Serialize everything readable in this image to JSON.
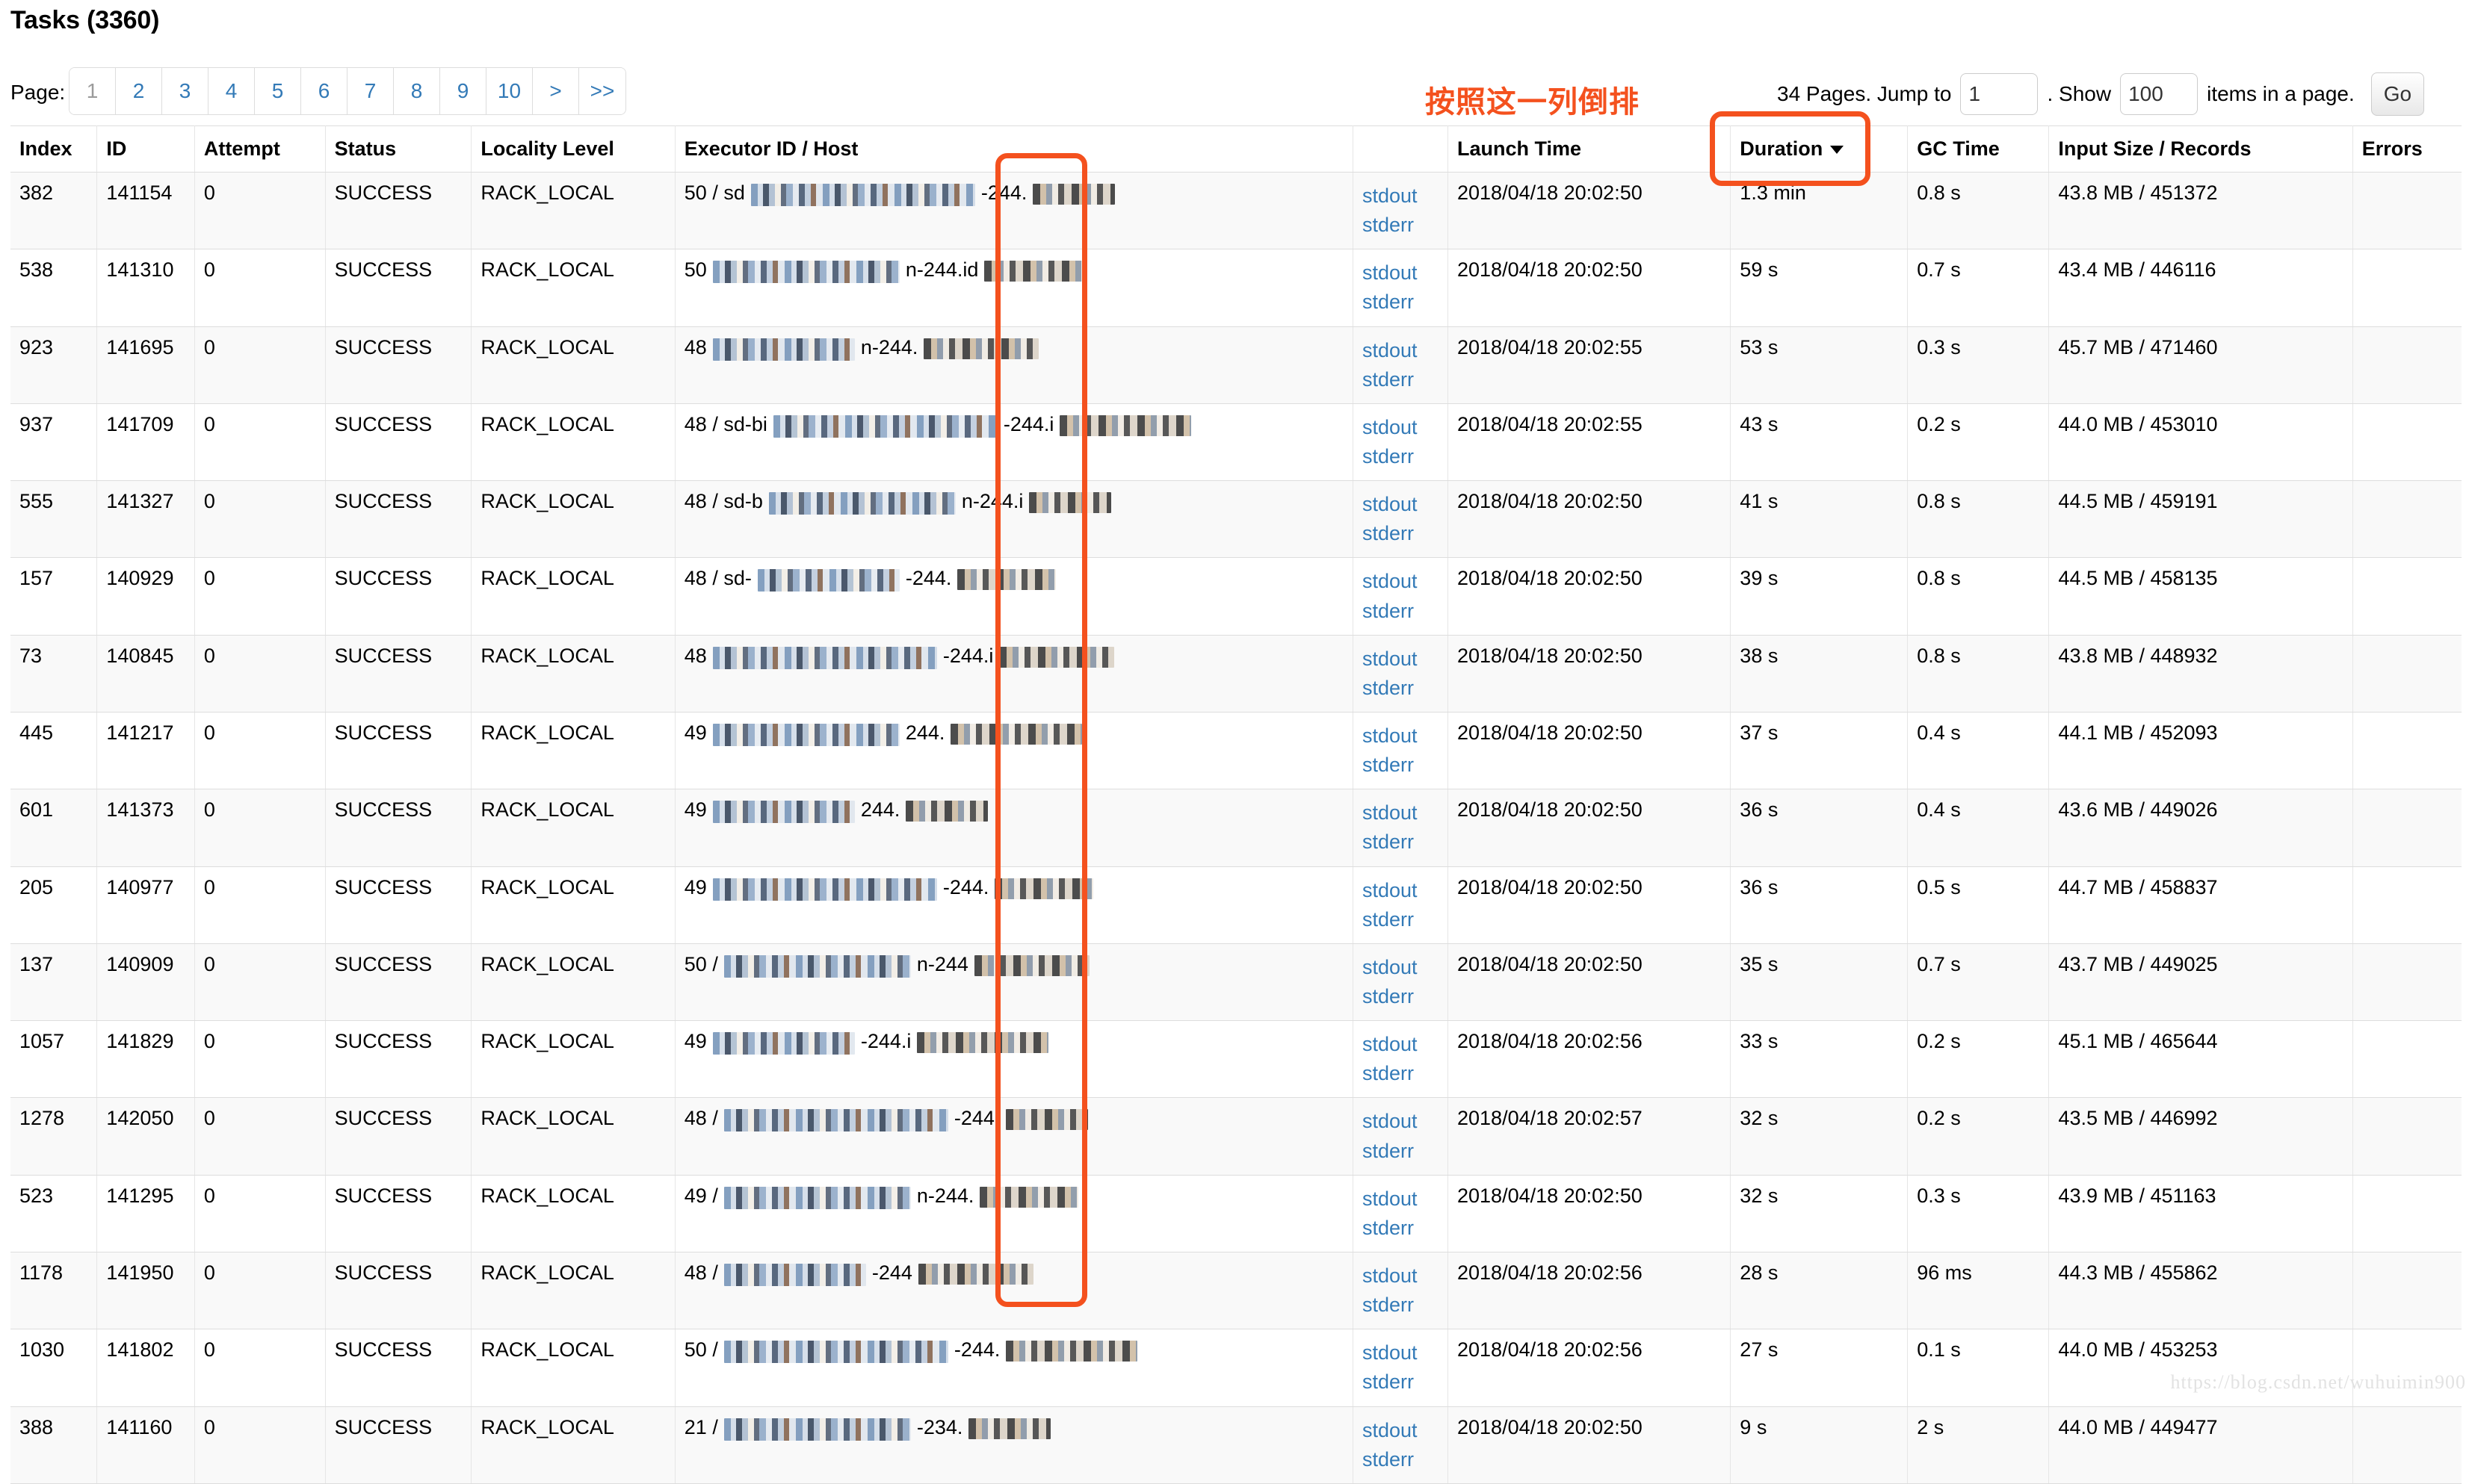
{
  "page_title": "Tasks (3360)",
  "accent_color": "#f4511e",
  "link_color": "#337ab7",
  "pagination": {
    "label": "Page:",
    "items": [
      "1",
      "2",
      "3",
      "4",
      "5",
      "6",
      "7",
      "8",
      "9",
      "10",
      ">",
      ">>"
    ],
    "current": "1"
  },
  "annotation": {
    "chinese_note": "按照这一列倒排"
  },
  "jump": {
    "pages_text": "34 Pages. Jump to",
    "jump_value": "1",
    "jump_placeholder": "1",
    "show_text": ". Show",
    "show_value": "100",
    "show_placeholder": "100",
    "items_text": "items in a page.",
    "go_label": "Go"
  },
  "table": {
    "headers": {
      "index": "Index",
      "id": "ID",
      "attempt": "Attempt",
      "status": "Status",
      "locality": "Locality Level",
      "executor": "Executor ID / Host",
      "logs": "",
      "launch_time": "Launch Time",
      "duration": "Duration",
      "gc_time": "GC Time",
      "input_size": "Input Size / Records",
      "errors": "Errors"
    },
    "sort_column": "Duration",
    "sort_direction": "desc",
    "log_labels": {
      "stdout": "stdout",
      "stderr": "stderr"
    },
    "rows": [
      {
        "index": "382",
        "id": "141154",
        "attempt": "0",
        "status": "SUCCESS",
        "locality": "RACK_LOCAL",
        "exec_id": "50 / sd",
        "host_frag": "-244.",
        "launch": "2018/04/18 20:02:50",
        "duration": "1.3 min",
        "gc": "0.8 s",
        "input": "43.8 MB / 451372",
        "errors": ""
      },
      {
        "index": "538",
        "id": "141310",
        "attempt": "0",
        "status": "SUCCESS",
        "locality": "RACK_LOCAL",
        "exec_id": "50",
        "host_frag": "n-244.id",
        "launch": "2018/04/18 20:02:50",
        "duration": "59 s",
        "gc": "0.7 s",
        "input": "43.4 MB / 446116",
        "errors": ""
      },
      {
        "index": "923",
        "id": "141695",
        "attempt": "0",
        "status": "SUCCESS",
        "locality": "RACK_LOCAL",
        "exec_id": "48",
        "host_frag": "n-244.",
        "launch": "2018/04/18 20:02:55",
        "duration": "53 s",
        "gc": "0.3 s",
        "input": "45.7 MB / 471460",
        "errors": ""
      },
      {
        "index": "937",
        "id": "141709",
        "attempt": "0",
        "status": "SUCCESS",
        "locality": "RACK_LOCAL",
        "exec_id": "48 / sd-bi",
        "host_frag": "-244.i",
        "launch": "2018/04/18 20:02:55",
        "duration": "43 s",
        "gc": "0.2 s",
        "input": "44.0 MB / 453010",
        "errors": ""
      },
      {
        "index": "555",
        "id": "141327",
        "attempt": "0",
        "status": "SUCCESS",
        "locality": "RACK_LOCAL",
        "exec_id": "48 / sd-b",
        "host_frag": "n-244.i",
        "launch": "2018/04/18 20:02:50",
        "duration": "41 s",
        "gc": "0.8 s",
        "input": "44.5 MB / 459191",
        "errors": ""
      },
      {
        "index": "157",
        "id": "140929",
        "attempt": "0",
        "status": "SUCCESS",
        "locality": "RACK_LOCAL",
        "exec_id": "48 / sd-",
        "host_frag": "-244.",
        "launch": "2018/04/18 20:02:50",
        "duration": "39 s",
        "gc": "0.8 s",
        "input": "44.5 MB / 458135",
        "errors": ""
      },
      {
        "index": "73",
        "id": "140845",
        "attempt": "0",
        "status": "SUCCESS",
        "locality": "RACK_LOCAL",
        "exec_id": "48",
        "host_frag": "-244.i",
        "launch": "2018/04/18 20:02:50",
        "duration": "38 s",
        "gc": "0.8 s",
        "input": "43.8 MB / 448932",
        "errors": ""
      },
      {
        "index": "445",
        "id": "141217",
        "attempt": "0",
        "status": "SUCCESS",
        "locality": "RACK_LOCAL",
        "exec_id": "49",
        "host_frag": "244.",
        "launch": "2018/04/18 20:02:50",
        "duration": "37 s",
        "gc": "0.4 s",
        "input": "44.1 MB / 452093",
        "errors": ""
      },
      {
        "index": "601",
        "id": "141373",
        "attempt": "0",
        "status": "SUCCESS",
        "locality": "RACK_LOCAL",
        "exec_id": "49",
        "host_frag": "244.",
        "launch": "2018/04/18 20:02:50",
        "duration": "36 s",
        "gc": "0.4 s",
        "input": "43.6 MB / 449026",
        "errors": ""
      },
      {
        "index": "205",
        "id": "140977",
        "attempt": "0",
        "status": "SUCCESS",
        "locality": "RACK_LOCAL",
        "exec_id": "49",
        "host_frag": "-244.",
        "launch": "2018/04/18 20:02:50",
        "duration": "36 s",
        "gc": "0.5 s",
        "input": "44.7 MB / 458837",
        "errors": ""
      },
      {
        "index": "137",
        "id": "140909",
        "attempt": "0",
        "status": "SUCCESS",
        "locality": "RACK_LOCAL",
        "exec_id": "50 /",
        "host_frag": "n-244",
        "launch": "2018/04/18 20:02:50",
        "duration": "35 s",
        "gc": "0.7 s",
        "input": "43.7 MB / 449025",
        "errors": ""
      },
      {
        "index": "1057",
        "id": "141829",
        "attempt": "0",
        "status": "SUCCESS",
        "locality": "RACK_LOCAL",
        "exec_id": "49",
        "host_frag": "-244.i",
        "launch": "2018/04/18 20:02:56",
        "duration": "33 s",
        "gc": "0.2 s",
        "input": "45.1 MB / 465644",
        "errors": ""
      },
      {
        "index": "1278",
        "id": "142050",
        "attempt": "0",
        "status": "SUCCESS",
        "locality": "RACK_LOCAL",
        "exec_id": "48 /",
        "host_frag": "-244.",
        "launch": "2018/04/18 20:02:57",
        "duration": "32 s",
        "gc": "0.2 s",
        "input": "43.5 MB / 446992",
        "errors": ""
      },
      {
        "index": "523",
        "id": "141295",
        "attempt": "0",
        "status": "SUCCESS",
        "locality": "RACK_LOCAL",
        "exec_id": "49 /",
        "host_frag": "n-244.",
        "launch": "2018/04/18 20:02:50",
        "duration": "32 s",
        "gc": "0.3 s",
        "input": "43.9 MB / 451163",
        "errors": ""
      },
      {
        "index": "1178",
        "id": "141950",
        "attempt": "0",
        "status": "SUCCESS",
        "locality": "RACK_LOCAL",
        "exec_id": "48 /",
        "host_frag": "-244",
        "launch": "2018/04/18 20:02:56",
        "duration": "28 s",
        "gc": "96 ms",
        "input": "44.3 MB / 455862",
        "errors": ""
      },
      {
        "index": "1030",
        "id": "141802",
        "attempt": "0",
        "status": "SUCCESS",
        "locality": "RACK_LOCAL",
        "exec_id": "50 /",
        "host_frag": "-244.",
        "launch": "2018/04/18 20:02:56",
        "duration": "27 s",
        "gc": "0.1 s",
        "input": "44.0 MB / 453253",
        "errors": ""
      },
      {
        "index": "388",
        "id": "141160",
        "attempt": "0",
        "status": "SUCCESS",
        "locality": "RACK_LOCAL",
        "exec_id": "21 /",
        "host_frag": "-234.",
        "launch": "2018/04/18 20:02:50",
        "duration": "9 s",
        "gc": "2 s",
        "input": "44.0 MB / 449477",
        "errors": ""
      }
    ]
  },
  "watermark": "https://blog.csdn.net/wuhuimin900"
}
